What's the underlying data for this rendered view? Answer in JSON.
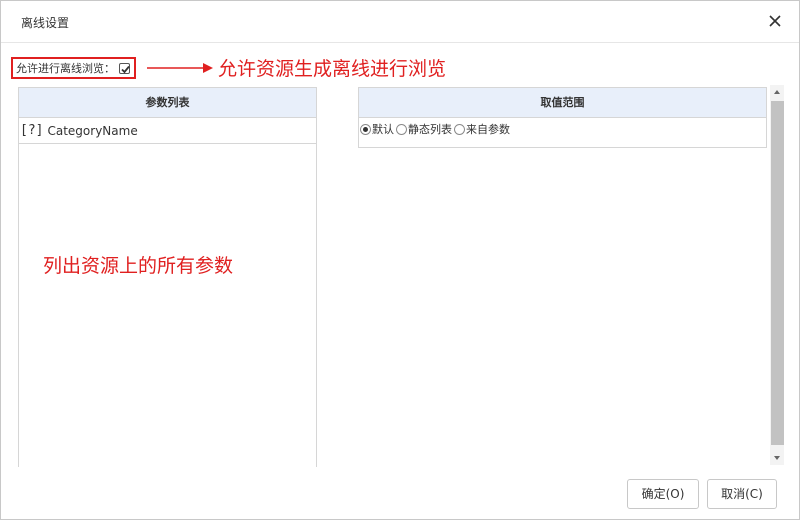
{
  "dialog": {
    "title": "离线设置",
    "close_icon": "close-icon"
  },
  "offline": {
    "label": "允许进行离线浏览：",
    "checked": true
  },
  "annotations": {
    "top": "允许资源生成离线进行浏览",
    "middle": "列出资源上的所有参数",
    "color": "#e02020"
  },
  "params": {
    "header": "参数列表",
    "rows": [
      {
        "type": "[?]",
        "name": "CategoryName"
      }
    ]
  },
  "range": {
    "header": "取值范围",
    "options": [
      {
        "label": "默认",
        "selected": true
      },
      {
        "label": "静态列表",
        "selected": false
      },
      {
        "label": "来自参数",
        "selected": false
      }
    ]
  },
  "buttons": {
    "ok": "确定(O)",
    "cancel": "取消(C)"
  },
  "colors": {
    "header_bg": "#e8effa",
    "border": "#d6d6d6",
    "annotation": "#e02020"
  }
}
